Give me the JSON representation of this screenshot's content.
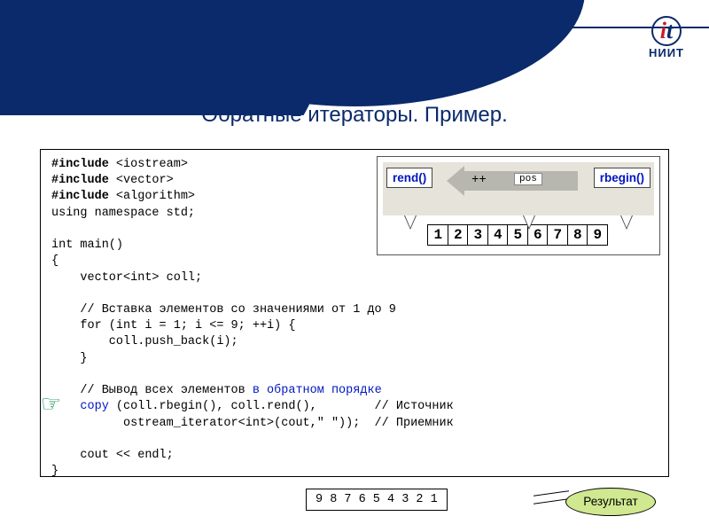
{
  "logo": {
    "sub": "НИИТ"
  },
  "title": "Обратные итераторы. Пример.",
  "code": {
    "inc1a": "#include",
    "inc1b": " <iostream>",
    "inc2a": "#include",
    "inc2b": " <vector>",
    "inc3a": "#include",
    "inc3b": " <algorithm>",
    "ns": "using namespace std;",
    "main": "int main()",
    "brace_o": "{",
    "decl": "    vector<int> coll;",
    "cmt1": "    // Вставка элементов со значениями от 1 до 9",
    "for": "    for (int i = 1; i <= 9; ++i) {",
    "push": "        coll.push_back(i);",
    "for_end": "    }",
    "cmt2a": "    // Вывод всех элементов ",
    "cmt2b": "в обратном порядке",
    "copy_kw": "    copy",
    "copy_args": " (coll.rbegin(), coll.rend(),        // Источник",
    "ostream": "          ostream_iterator<int>(cout,\" \"));  // Приемник",
    "cout": "    cout << endl;",
    "brace_c": "}"
  },
  "diagram": {
    "rend": "rend()",
    "rbegin": "rbegin()",
    "plus": "++",
    "pos": "pos",
    "cells": [
      "1",
      "2",
      "3",
      "4",
      "5",
      "6",
      "7",
      "8",
      "9"
    ]
  },
  "output": "9 8 7 6 5 4 3 2 1",
  "result_label": "Результат"
}
